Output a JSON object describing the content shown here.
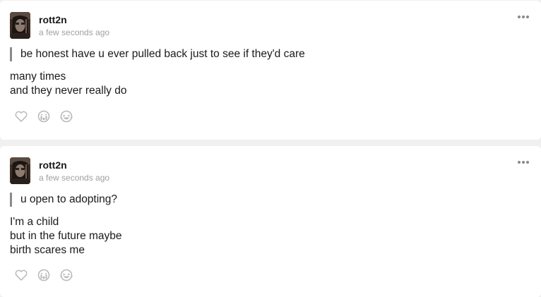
{
  "posts": [
    {
      "username": "rott2n",
      "timestamp": "a few seconds ago",
      "question": "be honest have u ever pulled back just to see if they'd care",
      "answer_lines": [
        "many times",
        "and they never really do"
      ]
    },
    {
      "username": "rott2n",
      "timestamp": "a few seconds ago",
      "question": "u open to adopting?",
      "answer_lines": [
        "I'm a child",
        "but in the future maybe",
        "birth scares me"
      ]
    }
  ],
  "icons": {
    "more": "more-dots-icon",
    "like": "heart-icon",
    "cry": "crying-face-icon",
    "laugh": "laughing-face-icon"
  },
  "colors": {
    "background": "#f0f0f0",
    "card": "#ffffff",
    "quote_bar": "#8a8a8a",
    "muted": "#a0a0a0",
    "icon": "#b8b8b8"
  }
}
